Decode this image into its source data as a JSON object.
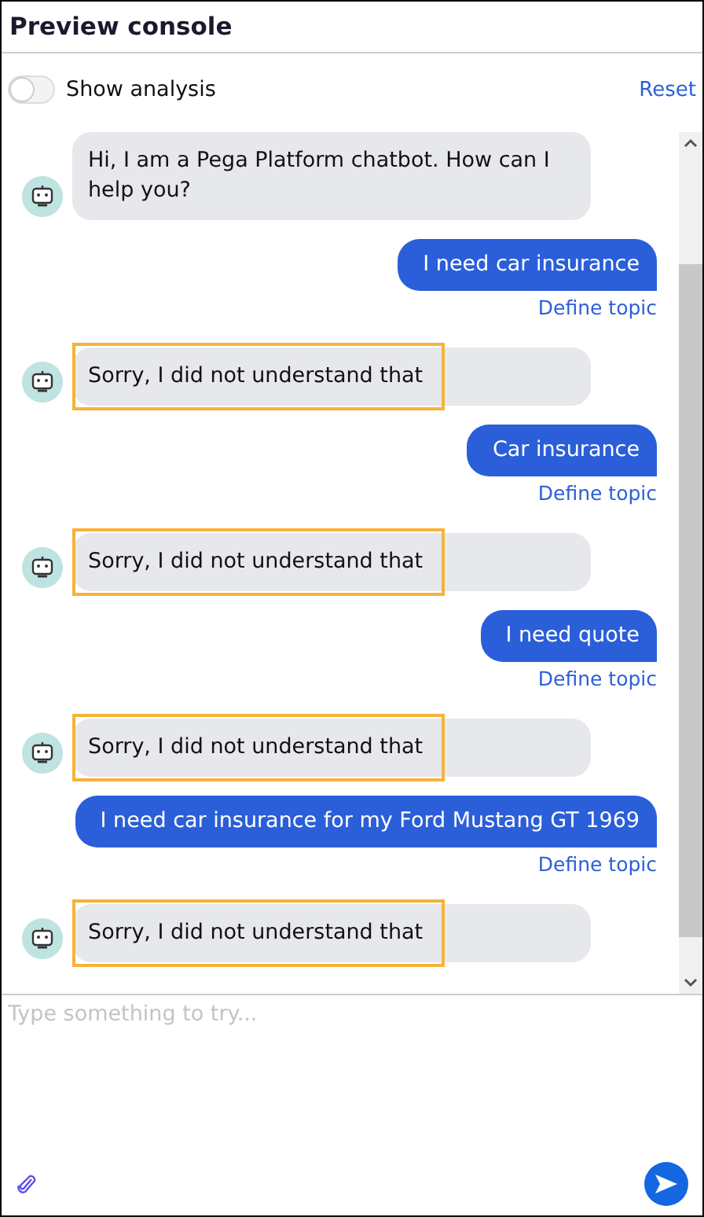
{
  "header": {
    "title": "Preview console"
  },
  "analysis_toggle": {
    "label": "Show analysis",
    "on": false
  },
  "reset_link": "Reset",
  "messages": [
    {
      "kind": "bot",
      "text": "Hi, I am a Pega Platform chatbot. How can I help you?",
      "highlighted": false
    },
    {
      "kind": "user",
      "text": "I need car insurance",
      "link": "Define topic"
    },
    {
      "kind": "bot",
      "text": "Sorry, I did not understand that",
      "highlighted": true
    },
    {
      "kind": "user",
      "text": "Car insurance",
      "link": "Define topic"
    },
    {
      "kind": "bot",
      "text": "Sorry, I did not understand that",
      "highlighted": true
    },
    {
      "kind": "user",
      "text": "I need quote",
      "link": "Define topic"
    },
    {
      "kind": "bot",
      "text": "Sorry, I did not understand that",
      "highlighted": true
    },
    {
      "kind": "user",
      "text": "I need car insurance for my Ford Mustang GT 1969",
      "link": "Define topic"
    },
    {
      "kind": "bot",
      "text": "Sorry, I did not understand that",
      "highlighted": true
    }
  ],
  "composer": {
    "placeholder": "Type something to try..."
  }
}
